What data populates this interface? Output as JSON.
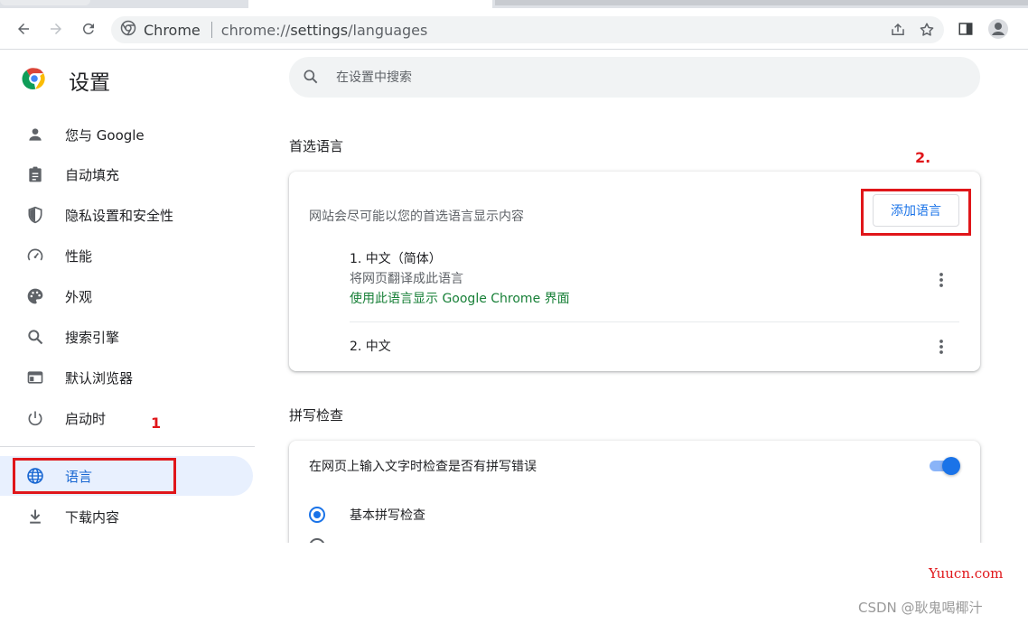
{
  "browser": {
    "url_chip": "Chrome",
    "url_prefix": "chrome://",
    "url_path": "settings",
    "url_suffix": "/languages"
  },
  "sidebar": {
    "title": "设置",
    "items": [
      {
        "label": "您与 Google",
        "icon": "person-icon"
      },
      {
        "label": "自动填充",
        "icon": "clipboard-icon"
      },
      {
        "label": "隐私设置和安全性",
        "icon": "shield-icon"
      },
      {
        "label": "性能",
        "icon": "speedometer-icon"
      },
      {
        "label": "外观",
        "icon": "palette-icon"
      },
      {
        "label": "搜索引擎",
        "icon": "search-icon"
      },
      {
        "label": "默认浏览器",
        "icon": "browser-window-icon"
      },
      {
        "label": "启动时",
        "icon": "power-icon"
      },
      {
        "label": "语言",
        "icon": "globe-icon",
        "active": true
      },
      {
        "label": "下载内容",
        "icon": "download-icon"
      }
    ]
  },
  "search": {
    "placeholder": "在设置中搜索"
  },
  "languages": {
    "section_title": "首选语言",
    "description": "网站会尽可能以您的首选语言显示内容",
    "add_button": "添加语言",
    "list": [
      {
        "name": "1. 中文（简体）",
        "sub": "将网页翻译成此语言",
        "ui_note": "使用此语言显示 Google Chrome 界面"
      },
      {
        "name": "2. 中文"
      }
    ]
  },
  "spellcheck": {
    "section_title": "拼写检查",
    "toggle_label": "在网页上输入文字时检查是否有拼写错误",
    "toggle_on": true,
    "option_basic": "基本拼写检查"
  },
  "annotations": {
    "step1": "1",
    "step2": "2."
  },
  "watermarks": {
    "site": "Yuucn.com",
    "csdn": "CSDN @耿鬼喝椰汁"
  },
  "colors": {
    "accent": "#1a73e8",
    "active_bg": "#e8f0fe",
    "green_note": "#188038",
    "annotation_red": "#e0161a"
  }
}
